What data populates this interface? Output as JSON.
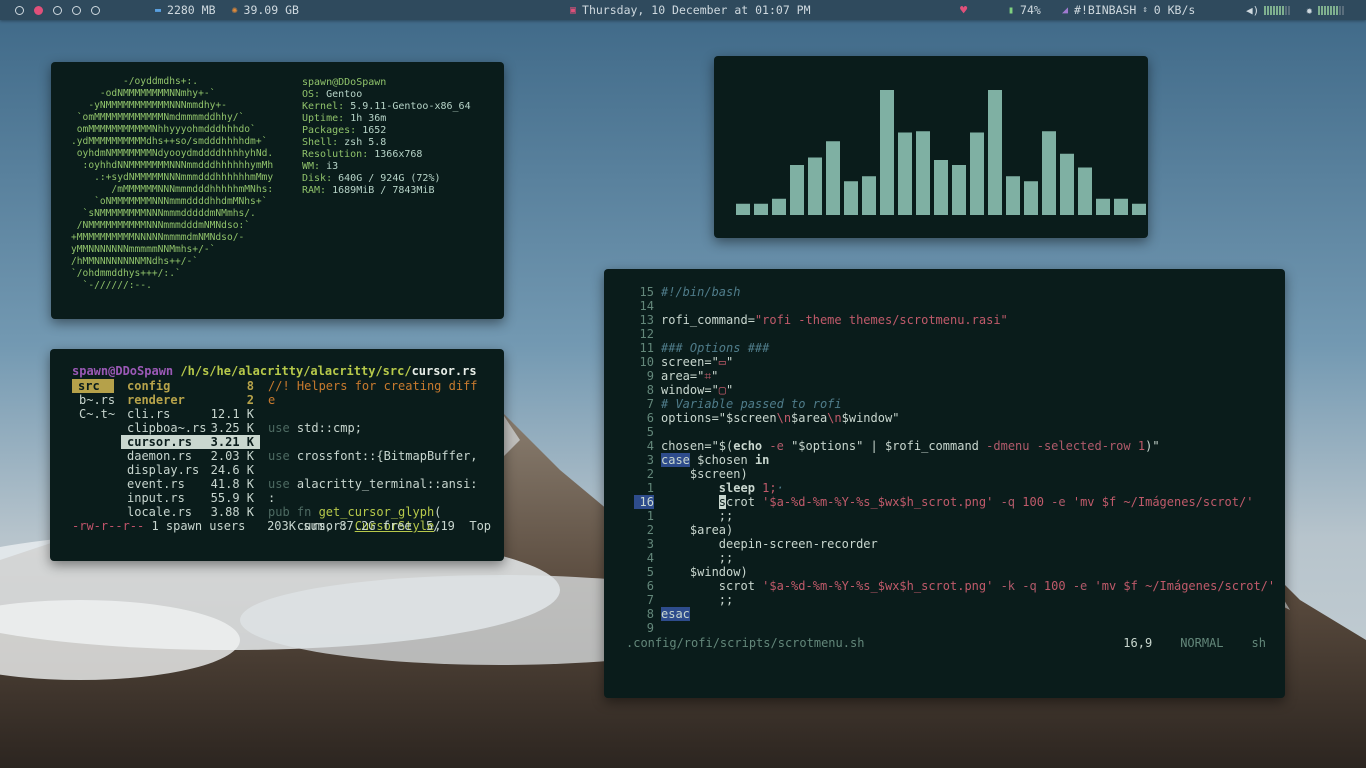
{
  "topbar": {
    "workspaces": [
      {
        "active": false
      },
      {
        "active": true
      },
      {
        "active": false
      },
      {
        "active": false
      },
      {
        "active": false
      }
    ],
    "memory": "2280 MB",
    "memory_icon": "memory-icon",
    "disk": "39.09 GB",
    "disk_icon": "disk-icon",
    "clock": "Thursday, 10 December at 01:07 PM",
    "clock_icon": "calendar-icon",
    "heart_icon": "heart-icon",
    "battery": "74%",
    "battery_icon": "battery-icon",
    "network_name": "#!BINBASH",
    "network_icon": "wifi-icon",
    "net_speed": "0 KB/s",
    "volume_icon": "volume-icon",
    "brightness_icon": "brightness-icon",
    "accent": "#e0507a"
  },
  "neofetch": {
    "logo": [
      "         -/oyddmdhs+:.",
      "     -odNMMMMMMMMNNmhy+-`",
      "   -yNMMMMMMMMMMMNNNmmdhy+-",
      " `omMMMMMMMMMMMMNmdmmmmddhhy/`",
      " omMMMMMMMMMMMNhhyyyohmdddhhhdo`",
      ".ydMMMMMMMMMMdhs++so/smdddhhhhdm+`",
      " oyhdmNMMMMMMMNdyooydmddddhhhhyhNd.",
      "  :oyhhdNNMMMMMMMNNNmmdddhhhhhhymMh",
      "    .:+sydNMMMMMNNNmmmdddhhhhhhmMmy",
      "       /mMMMMMMNNNmmmdddhhhhhmMNhs:",
      "    `oNMMMMMMMNNNmmmddddhhdmMNhs+`",
      "  `sNMMMMMMMMNNNmmmdddddmNMmhs/.",
      " /NMMMMMMMMMMNNNmmmdddmNMNdso:`",
      "+MMMMMMMMMMNNNNNmmmmdmNMNdso/-",
      "yMMNNNNNNNmmmmmNNMmhs+/-`",
      "/hMMNNNNNNNNMNdhs++/-`",
      "`/ohdmmddhys+++/:.`",
      "  `-//////:--."
    ],
    "user": "spawn",
    "host": "DDoSpawn",
    "info": [
      {
        "key": "OS:",
        "value": "Gentoo"
      },
      {
        "key": "Kernel:",
        "value": "5.9.11-Gentoo-x86_64"
      },
      {
        "key": "Uptime:",
        "value": "1h 36m"
      },
      {
        "key": "Packages:",
        "value": "1652"
      },
      {
        "key": "Shell:",
        "value": "zsh 5.8"
      },
      {
        "key": "Resolution:",
        "value": "1366x768"
      },
      {
        "key": "WM:",
        "value": "i3"
      },
      {
        "key": "Disk:",
        "value": "640G / 924G (72%)"
      },
      {
        "key": "RAM:",
        "value": "1689MiB / 7843MiB"
      }
    ]
  },
  "visualizer": {
    "bar_color": "#7fb0a3",
    "levels": [
      0.09,
      0.09,
      0.13,
      0.4,
      0.46,
      0.59,
      0.27,
      0.31,
      1.0,
      0.66,
      0.67,
      0.44,
      0.4,
      0.66,
      1.0,
      0.31,
      0.27,
      0.67,
      0.49,
      0.38,
      0.13,
      0.13,
      0.09
    ]
  },
  "filemgr": {
    "user": "spawn@DDoSpawn",
    "path": "/h/s/he/alacritty/alacritty/src/",
    "file": "cursor.rs",
    "parent": [
      "src",
      "b~.rs",
      "C~.t~"
    ],
    "entries": [
      {
        "name": "config",
        "size": "8",
        "type": "dir"
      },
      {
        "name": "renderer",
        "size": "2",
        "type": "dir"
      },
      {
        "name": "cli.rs",
        "size": "12.1 K",
        "type": "file"
      },
      {
        "name": "clipboa~.rs",
        "size": "3.25 K",
        "type": "file"
      },
      {
        "name": "cursor.rs",
        "size": "3.21 K",
        "type": "selected"
      },
      {
        "name": "daemon.rs",
        "size": "2.03 K",
        "type": "file"
      },
      {
        "name": "display.rs",
        "size": "24.6 K",
        "type": "file"
      },
      {
        "name": "event.rs",
        "size": "41.8 K",
        "type": "file"
      },
      {
        "name": "input.rs",
        "size": "55.9 K",
        "type": "file"
      },
      {
        "name": "locale.rs",
        "size": "3.88 K",
        "type": "file"
      }
    ],
    "preview": [
      {
        "parts": [
          {
            "t": "//! Helpers for creating diff",
            "c": "c"
          }
        ]
      },
      {
        "parts": [
          {
            "t": "e",
            "c": "c"
          }
        ]
      },
      {
        "parts": []
      },
      {
        "parts": [
          {
            "t": "use ",
            "c": "kw"
          },
          {
            "t": "std::cmp;",
            "c": "t"
          }
        ]
      },
      {
        "parts": []
      },
      {
        "parts": [
          {
            "t": "use ",
            "c": "kw"
          },
          {
            "t": "crossfont::{BitmapBuffer,",
            "c": "t"
          }
        ]
      },
      {
        "parts": []
      },
      {
        "parts": [
          {
            "t": "use ",
            "c": "kw"
          },
          {
            "t": "alacritty_terminal::ansi:",
            "c": "t"
          }
        ]
      },
      {
        "parts": [
          {
            "t": ":",
            "c": "t"
          }
        ]
      },
      {
        "parts": [
          {
            "t": "pub fn ",
            "c": "kw"
          },
          {
            "t": "get_cursor_glyph",
            "c": "fn"
          },
          {
            "t": "(",
            "c": "t"
          }
        ]
      },
      {
        "parts": [
          {
            "t": "    cursor: ",
            "c": "t"
          },
          {
            "t": "CursorStyle",
            "c": "ty"
          },
          {
            "t": ",",
            "c": "t"
          }
        ]
      }
    ],
    "status_perm": "-rw-r--r--",
    "status_rest": " 1 spawn users   203K sum, 87.2G free  5/19  Top"
  },
  "vim": {
    "lines": [
      {
        "n": "15",
        "parts": [
          {
            "t": "#!/bin/bash",
            "c": "cm"
          }
        ]
      },
      {
        "n": "14",
        "parts": []
      },
      {
        "n": "13",
        "parts": [
          {
            "t": "rofi_command=",
            "c": "tx"
          },
          {
            "t": "\"rofi -theme themes/scrotmenu.rasi\"",
            "c": "str"
          }
        ]
      },
      {
        "n": "12",
        "parts": []
      },
      {
        "n": "11",
        "parts": [
          {
            "t": "### Options ###",
            "c": "cm"
          }
        ]
      },
      {
        "n": "10",
        "parts": [
          {
            "t": "screen=\"",
            "c": "tx"
          },
          {
            "t": "▭",
            "c": "ic"
          },
          {
            "t": "\"",
            "c": "tx"
          }
        ]
      },
      {
        "n": "9",
        "parts": [
          {
            "t": "area=\"",
            "c": "tx"
          },
          {
            "t": "⌗",
            "c": "ic"
          },
          {
            "t": "\"",
            "c": "tx"
          }
        ]
      },
      {
        "n": "8",
        "parts": [
          {
            "t": "window=\"",
            "c": "tx"
          },
          {
            "t": "▢",
            "c": "ic"
          },
          {
            "t": "\"",
            "c": "tx"
          }
        ]
      },
      {
        "n": "7",
        "parts": [
          {
            "t": "# Variable passed to rofi",
            "c": "cm"
          }
        ]
      },
      {
        "n": "6",
        "parts": [
          {
            "t": "options=\"$screen",
            "c": "tx"
          },
          {
            "t": "\\n",
            "c": "str"
          },
          {
            "t": "$area",
            "c": "tx"
          },
          {
            "t": "\\n",
            "c": "str"
          },
          {
            "t": "$window\"",
            "c": "tx"
          }
        ]
      },
      {
        "n": "5",
        "parts": []
      },
      {
        "n": "4",
        "parts": [
          {
            "t": "chosen=\"$(",
            "c": "tx"
          },
          {
            "t": "echo",
            "c": "kwd"
          },
          {
            "t": " -e ",
            "c": "flag"
          },
          {
            "t": "\"$options\" | $rofi_command ",
            "c": "tx"
          },
          {
            "t": "-dmenu -selected-row ",
            "c": "flag"
          },
          {
            "t": "1",
            "c": "num"
          },
          {
            "t": ")\"",
            "c": "tx"
          }
        ]
      },
      {
        "n": "3",
        "parts": [
          {
            "t": "case",
            "c": "hl"
          },
          {
            "t": " $chosen ",
            "c": "tx"
          },
          {
            "t": "in",
            "c": "kwd"
          }
        ]
      },
      {
        "n": "2",
        "parts": [
          {
            "t": "    $screen)",
            "c": "tx"
          }
        ]
      },
      {
        "n": "1",
        "parts": [
          {
            "t": "        ",
            "c": "tx"
          },
          {
            "t": "sleep",
            "c": "kwd"
          },
          {
            "t": " 1;",
            "c": "num"
          },
          {
            "t": "·",
            "c": "cm"
          }
        ]
      },
      {
        "n": "16",
        "cur": true,
        "parts": [
          {
            "t": "        ",
            "c": "tx"
          },
          {
            "t": "s",
            "c": "cursor"
          },
          {
            "t": "crot ",
            "c": "tx"
          },
          {
            "t": "'$a-%d-%m-%Y-%s_$wx$h_scrot.png'",
            "c": "str"
          },
          {
            "t": " -q ",
            "c": "flag"
          },
          {
            "t": "100",
            "c": "num"
          },
          {
            "t": " -e ",
            "c": "flag"
          },
          {
            "t": "'mv $f ~/Imágenes/scrot/'",
            "c": "str"
          }
        ]
      },
      {
        "n": "1",
        "parts": [
          {
            "t": "        ;;",
            "c": "tx"
          }
        ]
      },
      {
        "n": "2",
        "parts": [
          {
            "t": "    $area)",
            "c": "tx"
          }
        ]
      },
      {
        "n": "3",
        "parts": [
          {
            "t": "        deepin-screen-recorder",
            "c": "tx"
          }
        ]
      },
      {
        "n": "4",
        "parts": [
          {
            "t": "        ;;",
            "c": "tx"
          }
        ]
      },
      {
        "n": "5",
        "parts": [
          {
            "t": "    $window)",
            "c": "tx"
          }
        ]
      },
      {
        "n": "6",
        "parts": [
          {
            "t": "        scrot ",
            "c": "tx"
          },
          {
            "t": "'$a-%d-%m-%Y-%s_$wx$h_scrot.png'",
            "c": "str"
          },
          {
            "t": " -k -q ",
            "c": "flag"
          },
          {
            "t": "100",
            "c": "num"
          },
          {
            "t": " -e ",
            "c": "flag"
          },
          {
            "t": "'mv $f ~/Imágenes/scrot/'",
            "c": "str"
          }
        ]
      },
      {
        "n": "7",
        "parts": [
          {
            "t": "        ;;",
            "c": "tx"
          }
        ]
      },
      {
        "n": "8",
        "parts": [
          {
            "t": "esac",
            "c": "hl"
          }
        ]
      },
      {
        "n": "9",
        "parts": []
      }
    ],
    "status": {
      "path": ".config/rofi/scripts/scrotmenu.sh",
      "position": "16,9",
      "mode": "NORMAL",
      "filetype": "sh"
    }
  }
}
